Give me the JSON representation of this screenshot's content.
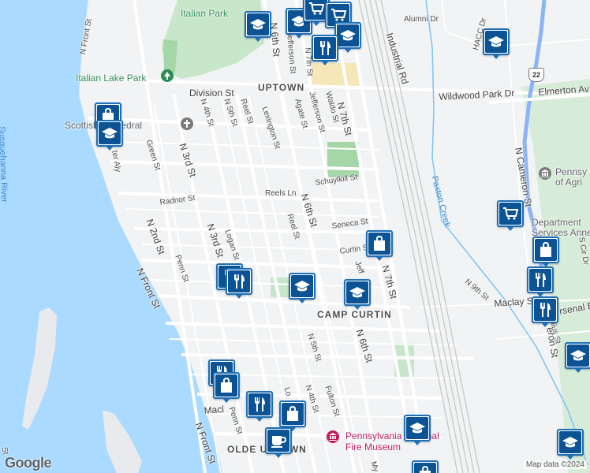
{
  "map": {
    "logo": "Google",
    "attribution": "Map data ©2024",
    "colors": {
      "water": "#aadaff",
      "land": "#f1f3f4",
      "park": "#c8e6c9",
      "road": "#ffffff",
      "highway": "#8ab4f8",
      "rail": "#c4c4c4",
      "pin": "#0b5394"
    },
    "labels": [
      {
        "id": "italian-park",
        "text": "Italian Park",
        "type": "park"
      },
      {
        "id": "italian-lake-park",
        "text": "Italian Lake Park",
        "type": "park"
      },
      {
        "id": "uptown",
        "text": "UPTOWN",
        "type": "area"
      },
      {
        "id": "camp-curtin",
        "text": "CAMP CURTIN",
        "type": "area"
      },
      {
        "id": "olde-uptown",
        "text": "OLDE UPTOWN",
        "type": "area"
      },
      {
        "id": "division-st",
        "text": "Division St",
        "type": "big"
      },
      {
        "id": "alumni-dr",
        "text": "Alumni Dr",
        "type": "street"
      },
      {
        "id": "industrial-rd",
        "text": "Industrial Rd",
        "type": "street"
      },
      {
        "id": "wildwood-park-dr",
        "text": "Wildwood Park Dr",
        "type": "big"
      },
      {
        "id": "elmerton-av",
        "text": "Elmerton Av",
        "type": "big"
      },
      {
        "id": "scottish-cathedral",
        "text": "Scottish Cathedral",
        "type": "poi"
      },
      {
        "id": "susquehanna-river",
        "text": "Susquehanna River",
        "type": "water"
      },
      {
        "id": "n-front-st-top",
        "text": "N Front St",
        "type": "street"
      },
      {
        "id": "n-front-st-mid",
        "text": "N Front St",
        "type": "big"
      },
      {
        "id": "n-front-st-bottom",
        "text": "N Front St",
        "type": "big"
      },
      {
        "id": "n-2nd-st",
        "text": "N 2nd St",
        "type": "big"
      },
      {
        "id": "n-3rd-st-a",
        "text": "N 3rd St",
        "type": "big"
      },
      {
        "id": "n-3rd-st-b",
        "text": "N 3rd St",
        "type": "big"
      },
      {
        "id": "n-4th-st-top",
        "text": "N 4th St",
        "type": "street"
      },
      {
        "id": "n-4th-st-bottom",
        "text": "N 4th St",
        "type": "street"
      },
      {
        "id": "n-5th-st-top",
        "text": "N 5th St",
        "type": "street"
      },
      {
        "id": "n-5th-st-bottom",
        "text": "N 5th St",
        "type": "street"
      },
      {
        "id": "n-6th-st-top",
        "text": "N 6th St",
        "type": "big"
      },
      {
        "id": "n-6th-st-mid",
        "text": "N 6th St",
        "type": "big"
      },
      {
        "id": "n-6th-st-bottom",
        "text": "N 6th St",
        "type": "big"
      },
      {
        "id": "n-7th-st-top",
        "text": "N 7th St",
        "type": "street"
      },
      {
        "id": "n-7th-st-mid",
        "text": "N 7th St",
        "type": "big"
      },
      {
        "id": "n-7th-st-low",
        "text": "N 7th St",
        "type": "big"
      },
      {
        "id": "jefferson-st-top",
        "text": "Jefferson St",
        "type": "street"
      },
      {
        "id": "jefferson-st-mid",
        "text": "Jefferson St",
        "type": "street"
      },
      {
        "id": "jeff-st",
        "text": "Jeff",
        "type": "street"
      },
      {
        "id": "waldo-st",
        "text": "Waldo St",
        "type": "street"
      },
      {
        "id": "agate-st",
        "text": "Agate St",
        "type": "street"
      },
      {
        "id": "lexington-st",
        "text": "Lexington St",
        "type": "street"
      },
      {
        "id": "reel-st-top",
        "text": "Reel St",
        "type": "street"
      },
      {
        "id": "reel-st-mid",
        "text": "Reel St",
        "type": "street"
      },
      {
        "id": "reels-ln",
        "text": "Reels Ln",
        "type": "street"
      },
      {
        "id": "schuylkill-st",
        "text": "Schuylkill St",
        "type": "street"
      },
      {
        "id": "seneca-st",
        "text": "Seneca St",
        "type": "street"
      },
      {
        "id": "curtin-st",
        "text": "Curtin St",
        "type": "street"
      },
      {
        "id": "green-st",
        "text": "Green St",
        "type": "street"
      },
      {
        "id": "radnor-st",
        "text": "Radnor St",
        "type": "street"
      },
      {
        "id": "logan-st",
        "text": "Logan St",
        "type": "street"
      },
      {
        "id": "penn-st-mid",
        "text": "Penn St",
        "type": "street"
      },
      {
        "id": "penn-st-bottom",
        "text": "Penn St",
        "type": "street"
      },
      {
        "id": "fulton-st",
        "text": "Fulton St",
        "type": "street"
      },
      {
        "id": "lo-st",
        "text": "Lo",
        "type": "street"
      },
      {
        "id": "macl-a",
        "text": "Macl",
        "type": "big"
      },
      {
        "id": "maclay-st",
        "text": "Maclay St",
        "type": "big"
      },
      {
        "id": "my-st",
        "text": "My",
        "type": "street"
      },
      {
        "id": "ter-aly",
        "text": "ter Aly",
        "type": "street"
      },
      {
        "id": "n-9th-st",
        "text": "N 9th St",
        "type": "street"
      },
      {
        "id": "paxton-creek",
        "text": "Paxton Creek",
        "type": "water"
      },
      {
        "id": "hacc-dr",
        "text": "HACC Dr",
        "type": "street"
      },
      {
        "id": "n-cameron-st-top",
        "text": "N Cameron St",
        "type": "big"
      },
      {
        "id": "cameron-st-bottom",
        "text": "eron St",
        "type": "big"
      },
      {
        "id": "s-cir-dr",
        "text": "S Cir Dr",
        "type": "street"
      },
      {
        "id": "arsenal-bl",
        "text": "rsenal Bl",
        "type": "big"
      },
      {
        "id": "julius-st",
        "text": "Julius St",
        "type": "street"
      },
      {
        "id": "ag-building",
        "text": "Pennsy\nof Agri",
        "type": "poi"
      },
      {
        "id": "dept-services",
        "text": "Department\nServices Anne",
        "type": "poi"
      },
      {
        "id": "fire-museum",
        "text": "Pennsylvania National\nFire Museum",
        "type": "museum"
      },
      {
        "id": "route-22",
        "text": "22",
        "type": "shield"
      },
      {
        "id": "st-bottom-left",
        "text": "St",
        "type": "street"
      }
    ],
    "pins": [
      {
        "name": "school-pin-1",
        "icon": "graduation-cap-icon"
      },
      {
        "name": "school-pin-2",
        "icon": "graduation-cap-icon"
      },
      {
        "name": "grocery-pin-1",
        "icon": "shopping-cart-icon"
      },
      {
        "name": "grocery-pin-2",
        "icon": "shopping-cart-icon"
      },
      {
        "name": "school-pin-3",
        "icon": "graduation-cap-icon"
      },
      {
        "name": "restaurant-pin-1",
        "icon": "fork-knife-icon"
      },
      {
        "name": "school-pin-4",
        "icon": "graduation-cap-icon"
      },
      {
        "name": "shopping-pin-1",
        "icon": "shopping-bag-icon"
      },
      {
        "name": "school-pin-5",
        "icon": "graduation-cap-icon"
      },
      {
        "name": "grocery-pin-3",
        "icon": "shopping-cart-icon"
      },
      {
        "name": "shopping-pin-2",
        "icon": "shopping-bag-icon"
      },
      {
        "name": "restaurant-pin-2",
        "icon": "fork-knife-icon"
      },
      {
        "name": "school-pin-6",
        "icon": "graduation-cap-icon"
      },
      {
        "name": "school-pin-7",
        "icon": "graduation-cap-icon"
      },
      {
        "name": "restaurant-pin-3",
        "icon": "fork-knife-icon"
      },
      {
        "name": "restaurant-pin-4",
        "icon": "fork-knife-icon"
      },
      {
        "name": "restaurant-pin-5",
        "icon": "fork-knife-icon"
      },
      {
        "name": "school-pin-8",
        "icon": "graduation-cap-icon"
      },
      {
        "name": "restaurant-pin-6",
        "icon": "fork-knife-icon"
      },
      {
        "name": "shopping-pin-3",
        "icon": "shopping-bag-icon"
      },
      {
        "name": "restaurant-pin-7",
        "icon": "fork-knife-icon"
      },
      {
        "name": "shopping-pin-4",
        "icon": "shopping-bag-icon"
      },
      {
        "name": "school-pin-9",
        "icon": "graduation-cap-icon"
      },
      {
        "name": "cafe-pin-1",
        "icon": "coffee-cup-icon"
      },
      {
        "name": "shopping-pin-5",
        "icon": "shopping-bag-icon"
      },
      {
        "name": "school-pin-10",
        "icon": "graduation-cap-icon"
      }
    ]
  }
}
